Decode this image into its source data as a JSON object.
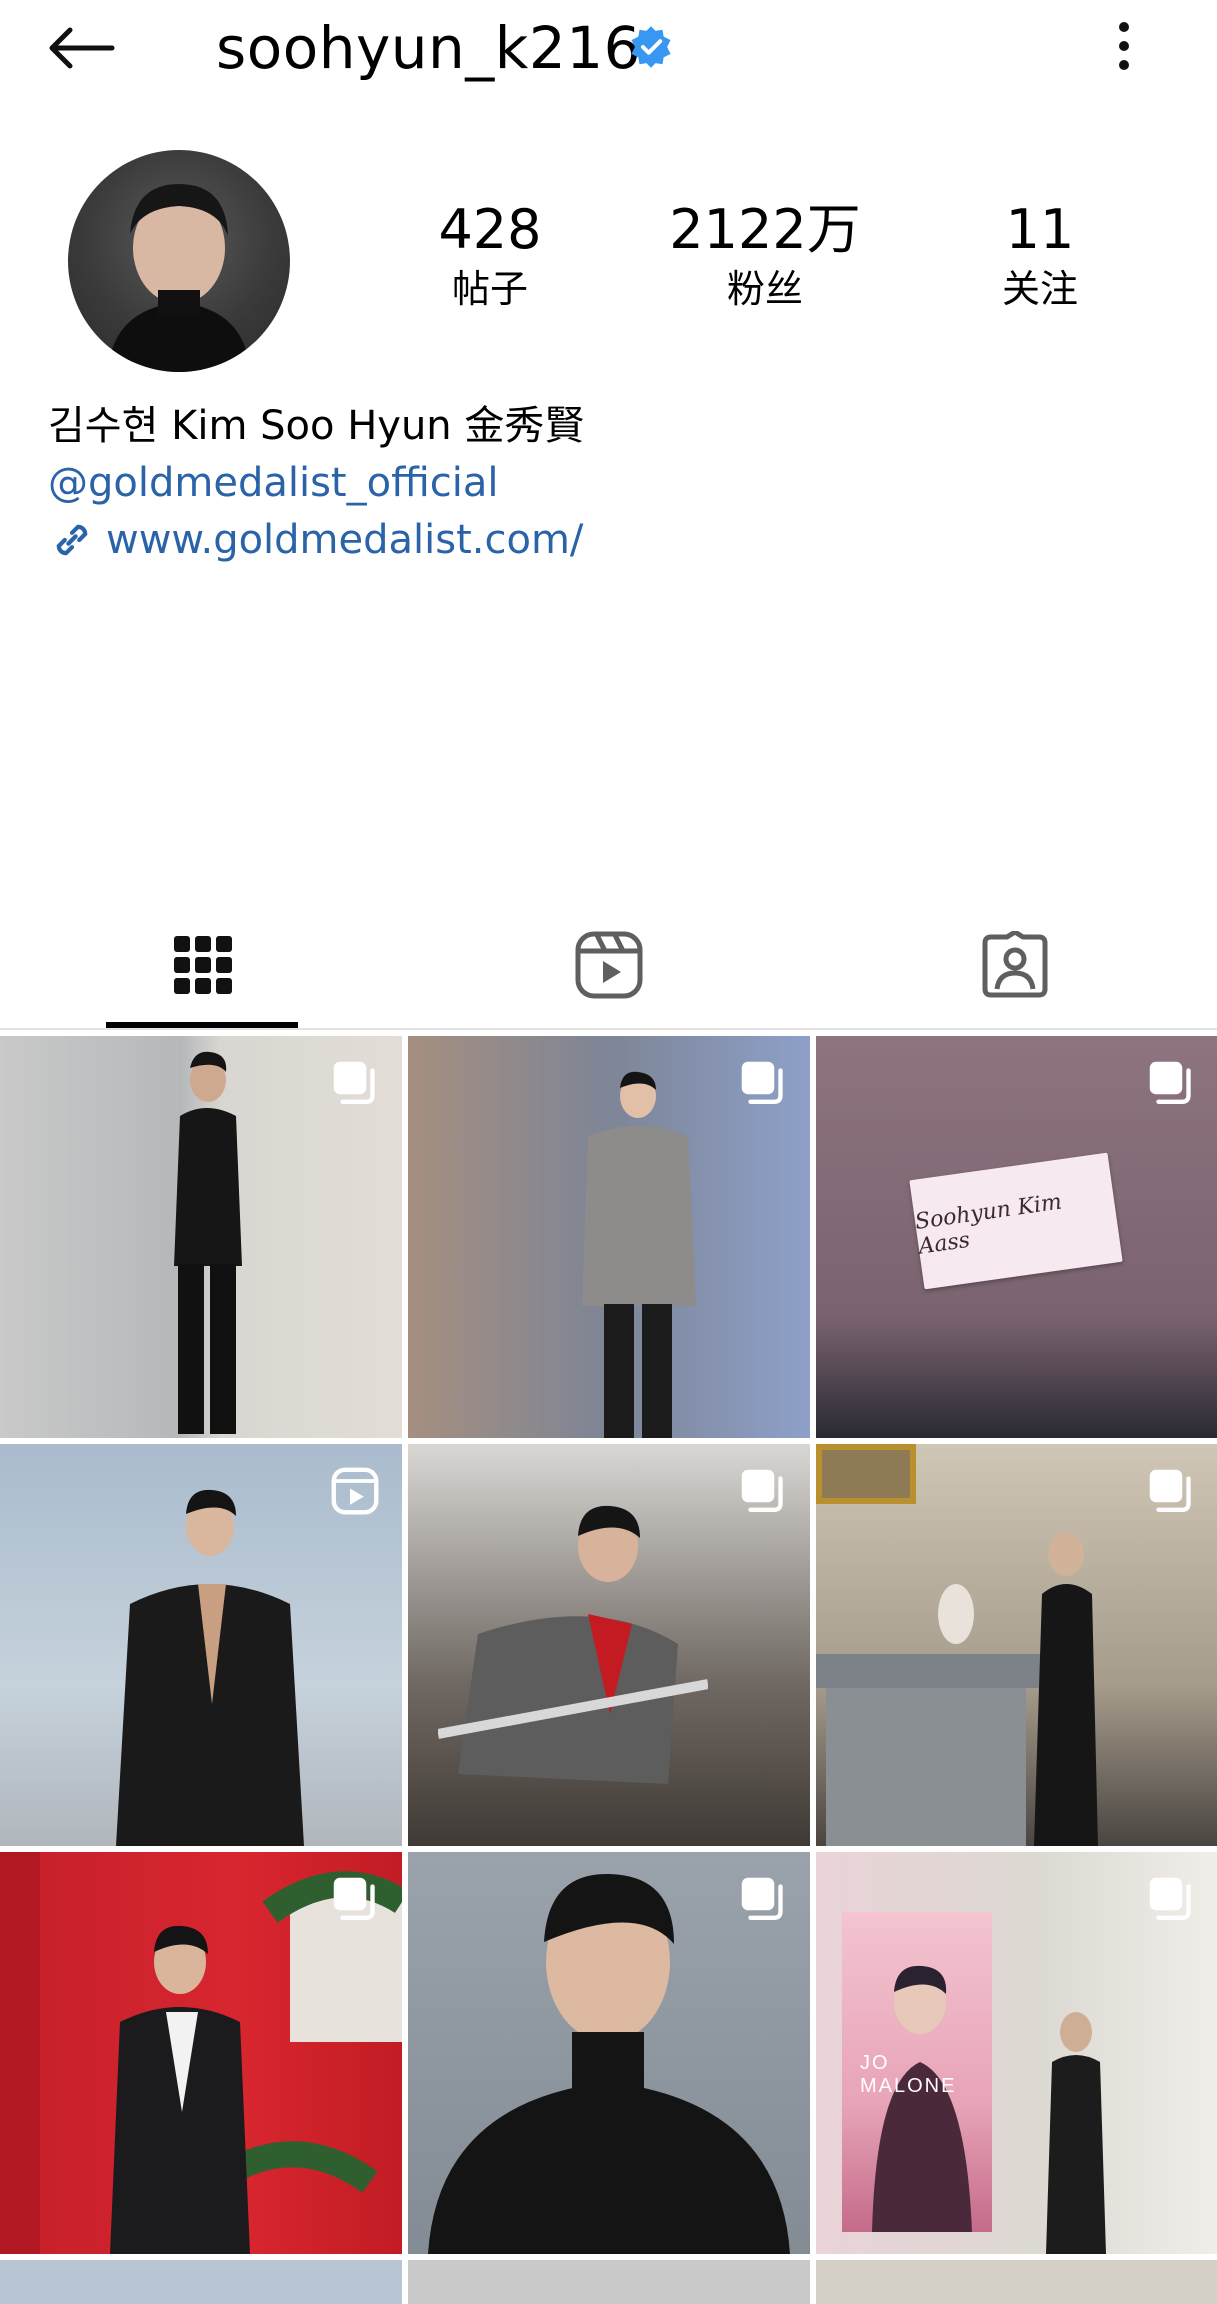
{
  "header": {
    "username": "soohyun_k216",
    "verified": true
  },
  "stats": {
    "posts_count": "428",
    "posts_label": "帖子",
    "followers_count": "2122万",
    "followers_label": "粉丝",
    "following_count": "11",
    "following_label": "关注"
  },
  "bio": {
    "name": "김수현 Kim Soo Hyun 金秀賢",
    "handle": "@goldmedalist_official",
    "link": "www.goldmedalist.com/"
  },
  "tabs": [
    {
      "icon": "grid-icon",
      "active": true
    },
    {
      "icon": "reels-icon",
      "active": false
    },
    {
      "icon": "tagged-icon",
      "active": false
    }
  ],
  "grid": {
    "tiles": [
      {
        "badge": "carousel-icon"
      },
      {
        "badge": "carousel-icon"
      },
      {
        "badge": "carousel-icon",
        "card_text": "Soohyun Kim Aass"
      },
      {
        "badge": "reels-icon"
      },
      {
        "badge": "carousel-icon"
      },
      {
        "badge": "carousel-icon"
      },
      {
        "badge": "carousel-icon"
      },
      {
        "badge": "carousel-icon"
      },
      {
        "badge": "carousel-icon",
        "poster_text": "JO MALONE"
      }
    ]
  },
  "colors": {
    "link_blue": "#2a63a8",
    "verified_blue": "#3897f0"
  }
}
